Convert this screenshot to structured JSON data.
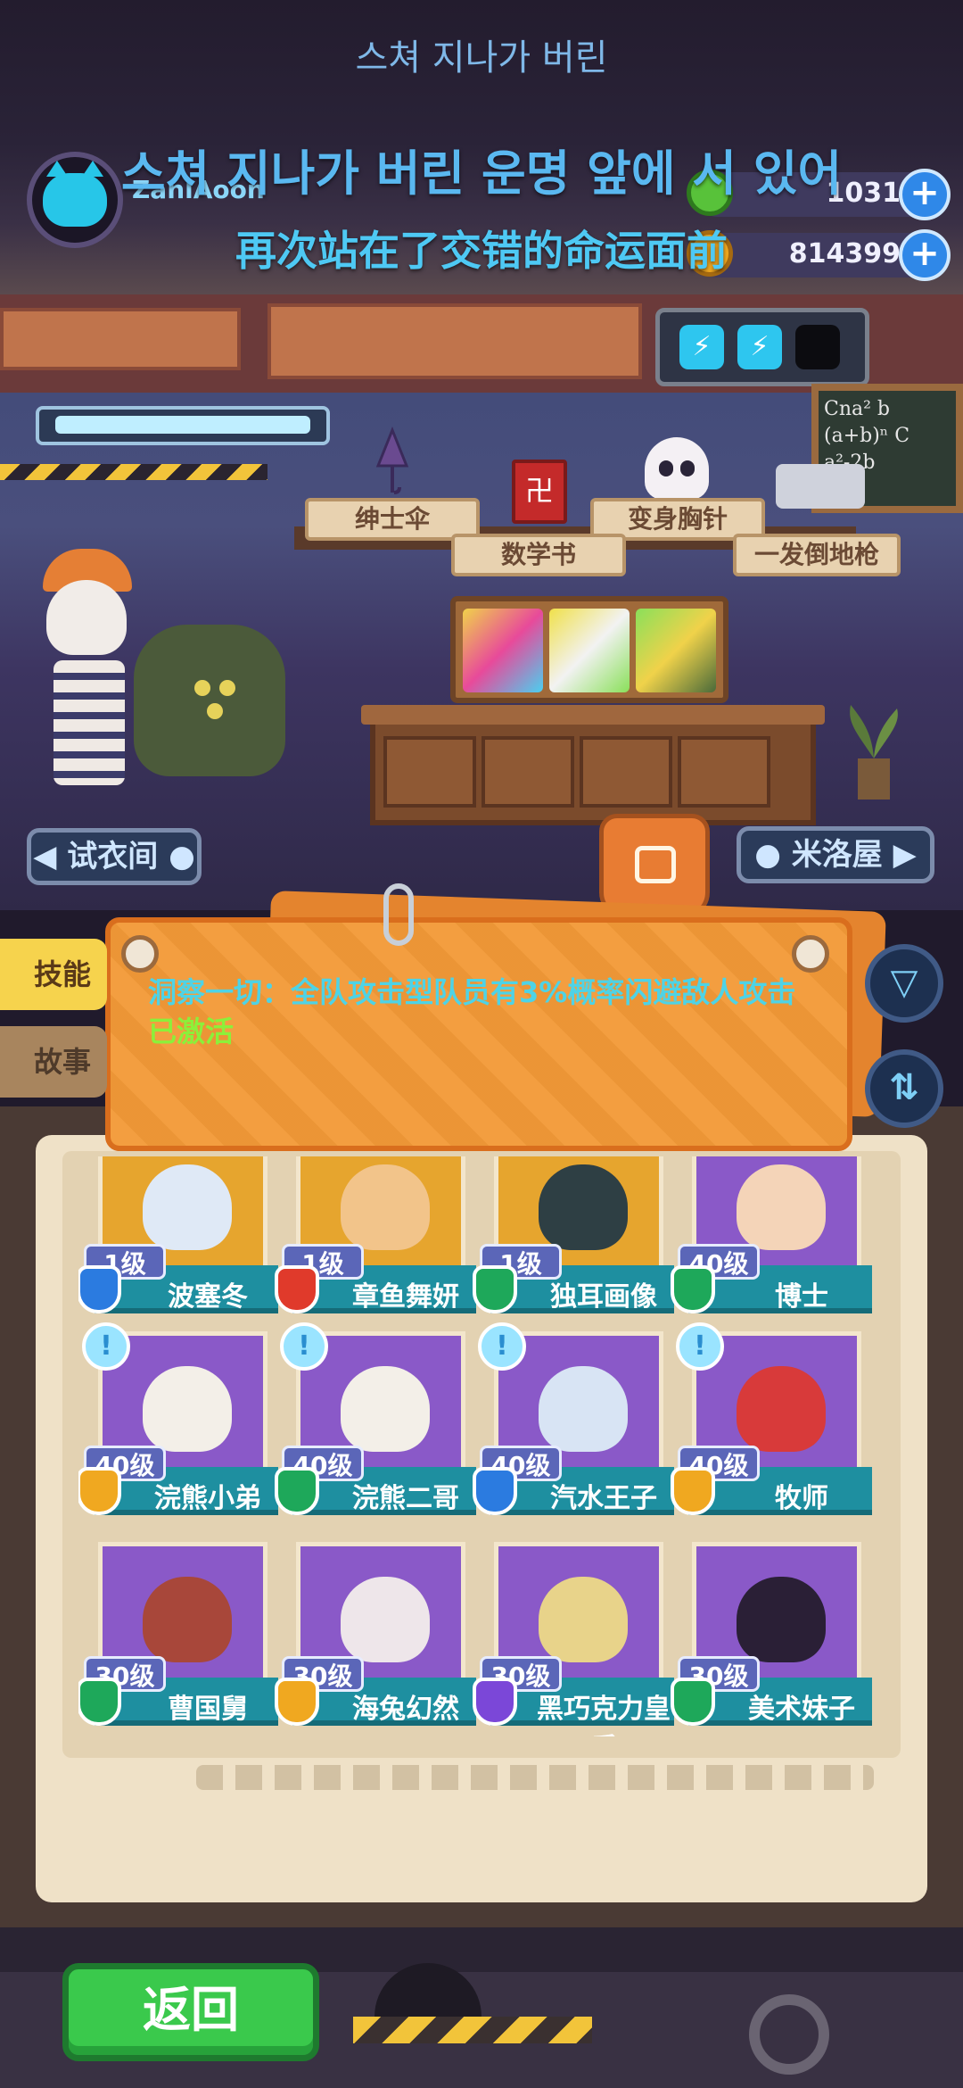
{
  "lyrics": {
    "top": "스쳐 지나가 버린",
    "korean": "스쳐 지나가 버린 운명 앞에 서 있어",
    "chinese": "再次站在了交错的命运面前"
  },
  "player": {
    "name": "ZanlAoon"
  },
  "resources": [
    {
      "icon": "green-gem-icon",
      "value": "1031",
      "color": "#58c23a"
    },
    {
      "icon": "gold-coin-icon",
      "value": "814399",
      "color": "#f0a820"
    }
  ],
  "energy": {
    "symbol": "⚡"
  },
  "chalkboard": {
    "lines": [
      "Cna² b",
      "(a+b)ⁿ C",
      "a²-2b"
    ]
  },
  "items": {
    "umbrella": "绅士伞",
    "math_book": "数学书",
    "brooch": "变身胸针",
    "gun": "一发倒地枪"
  },
  "book_symbol": "卍",
  "nav": {
    "left": "◀ 试衣间 ●",
    "right": "● 米洛屋 ▶"
  },
  "tabs": {
    "skill": "技能",
    "story": "故事"
  },
  "skill": {
    "description": "洞察一切：全队攻击型队员有3%概率闪避敌人攻击",
    "status": "已激活"
  },
  "side_buttons": {
    "filter": "▽",
    "sort": "⇅"
  },
  "characters": [
    {
      "name": "波塞冬",
      "level": "1级",
      "role": "blue",
      "portrait": "yellow",
      "bubble": false,
      "face": "#dfe9f6"
    },
    {
      "name": "章鱼舞妍",
      "level": "1级",
      "role": "red",
      "portrait": "yellow",
      "bubble": false,
      "face": "#f2c48a"
    },
    {
      "name": "独耳画像",
      "level": "1级",
      "role": "green",
      "portrait": "yellow",
      "bubble": false,
      "face": "#2e3f44"
    },
    {
      "name": "博士",
      "level": "40级",
      "role": "green",
      "portrait": "purple",
      "bubble": false,
      "face": "#f4d4b8"
    },
    {
      "name": "浣熊小弟",
      "level": "40级",
      "role": "gold",
      "portrait": "purple",
      "bubble": true,
      "face": "#f3efe8"
    },
    {
      "name": "浣熊二哥",
      "level": "40级",
      "role": "green",
      "portrait": "purple",
      "bubble": true,
      "face": "#f3efe8"
    },
    {
      "name": "汽水王子",
      "level": "40级",
      "role": "blue",
      "portrait": "purple",
      "bubble": true,
      "face": "#d8e4f4"
    },
    {
      "name": "牧师",
      "level": "40级",
      "role": "gold",
      "portrait": "purple",
      "bubble": true,
      "face": "#d83a3a"
    },
    {
      "name": "曹国舅",
      "level": "30级",
      "role": "green",
      "portrait": "purple",
      "bubble": false,
      "face": "#a8473a"
    },
    {
      "name": "海兔幻然",
      "level": "30级",
      "role": "gold",
      "portrait": "purple",
      "bubble": false,
      "face": "#eee6ea"
    },
    {
      "name": "黑巧克力皇后",
      "level": "30级",
      "role": "purple",
      "portrait": "purple",
      "bubble": false,
      "face": "#e8d38a"
    },
    {
      "name": "美术妹子",
      "level": "30级",
      "role": "green",
      "portrait": "purple",
      "bubble": false,
      "face": "#2a1f36"
    }
  ],
  "bubble_symbol": "!",
  "footer": {
    "back": "返回"
  }
}
